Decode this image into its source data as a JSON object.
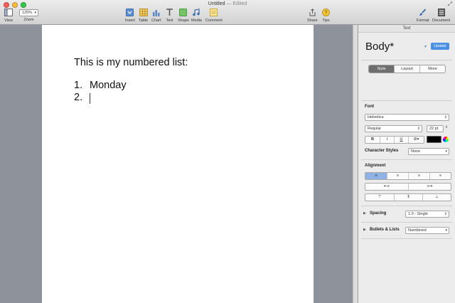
{
  "window": {
    "title": "Untitled",
    "edited": "— Edited"
  },
  "toolbar": {
    "view": "View",
    "zoom_value": "125%",
    "zoom": "Zoom",
    "insert": "Insert",
    "table": "Table",
    "chart": "Chart",
    "text": "Text",
    "shape": "Shape",
    "media": "Media",
    "comment": "Comment",
    "share": "Share",
    "tips": "Tips",
    "format": "Format",
    "document": "Document"
  },
  "document": {
    "heading": "This is my numbered list:",
    "items": [
      {
        "number": "1.",
        "text": "Monday"
      },
      {
        "number": "2.",
        "text": ""
      }
    ]
  },
  "inspector": {
    "header": "Text",
    "style_name": "Body*",
    "update": "Update",
    "tabs": [
      "Style",
      "Layout",
      "More"
    ],
    "active_tab": "Style",
    "font_label": "Font",
    "font_family": "Helvetica",
    "font_style": "Regular",
    "font_size": "22 pt",
    "text_color": "#000000",
    "format_buttons": [
      "B",
      "I",
      "U",
      "⚙▾"
    ],
    "char_styles_label": "Character Styles",
    "char_styles_value": "None",
    "alignment_label": "Alignment",
    "spacing_label": "Spacing",
    "spacing_value": "1.0 - Single",
    "bullets_label": "Bullets & Lists",
    "bullets_value": "Numbered"
  },
  "colors": {
    "workspace": "#8d929b",
    "update_button": "#4a90e2",
    "active_alignment": "#8fb1e3"
  }
}
